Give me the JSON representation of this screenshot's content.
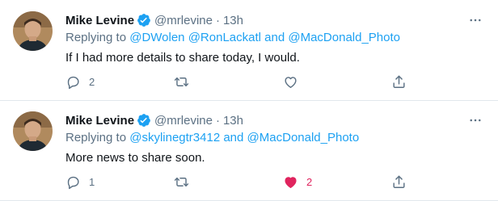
{
  "colors": {
    "link": "#1da1f2",
    "secondary_text": "#5b7083",
    "primary_text": "#0f1419",
    "like_active": "#e0245e",
    "divider": "#e1e8ed"
  },
  "tweets": [
    {
      "author": {
        "name": "Mike Levine",
        "verified": true,
        "handle": "@mrlevine",
        "time": "13h"
      },
      "replying_prefix": "Replying to",
      "mentions": [
        "@DWolen",
        "@RonLackatl",
        "@MacDonald_Photo"
      ],
      "and_word": "and",
      "text": "If I had more details to share today, I would.",
      "reply_count": "2",
      "retweet_count": "",
      "like_count": "",
      "liked": false
    },
    {
      "author": {
        "name": "Mike Levine",
        "verified": true,
        "handle": "@mrlevine",
        "time": "13h"
      },
      "replying_prefix": "Replying to",
      "mentions": [
        "@skylinegtr3412",
        "@MacDonald_Photo"
      ],
      "and_word": "and",
      "text": "More news to share soon.",
      "reply_count": "1",
      "retweet_count": "",
      "like_count": "2",
      "liked": true
    }
  ],
  "icons": {
    "avatar": "avatar-photo",
    "verified": "verified-badge-icon",
    "more": "more-horizontal-icon",
    "reply": "reply-icon",
    "retweet": "retweet-icon",
    "like": "heart-icon",
    "share": "share-icon"
  }
}
